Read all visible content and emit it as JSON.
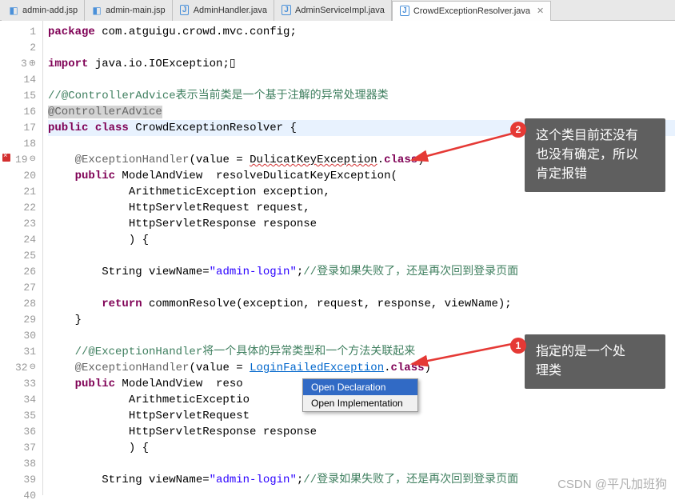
{
  "tabs": [
    {
      "label": "admin-add.jsp",
      "type": "jsp",
      "active": false
    },
    {
      "label": "admin-main.jsp",
      "type": "jsp",
      "active": false
    },
    {
      "label": "AdminHandler.java",
      "type": "java",
      "active": false
    },
    {
      "label": "AdminServiceImpl.java",
      "type": "java",
      "active": false
    },
    {
      "label": "CrowdExceptionResolver.java",
      "type": "java",
      "active": true
    }
  ],
  "gutter": {
    "start": 1,
    "lines": [
      {
        "n": "1"
      },
      {
        "n": "2"
      },
      {
        "n": "3",
        "plus": true,
        "fold": true,
        "dot": true
      },
      {
        "n": "14"
      },
      {
        "n": "15"
      },
      {
        "n": "16"
      },
      {
        "n": "17"
      },
      {
        "n": "18"
      },
      {
        "n": "19",
        "err": true,
        "fold": true
      },
      {
        "n": "20"
      },
      {
        "n": "21"
      },
      {
        "n": "22"
      },
      {
        "n": "23"
      },
      {
        "n": "24"
      },
      {
        "n": "25"
      },
      {
        "n": "26"
      },
      {
        "n": "27"
      },
      {
        "n": "28"
      },
      {
        "n": "29"
      },
      {
        "n": "30"
      },
      {
        "n": "31"
      },
      {
        "n": "32",
        "fold": true,
        "dot": true
      },
      {
        "n": "33"
      },
      {
        "n": "34"
      },
      {
        "n": "35"
      },
      {
        "n": "36"
      },
      {
        "n": "37"
      },
      {
        "n": "38"
      },
      {
        "n": "39"
      },
      {
        "n": "40"
      }
    ]
  },
  "code": {
    "l1": {
      "kw1": "package",
      "pkg": " com.atguigu.crowd.mvc.config;"
    },
    "l3": {
      "kw1": "import",
      "pkg": " java.io.IOException;"
    },
    "l15": {
      "cmt": "//@ControllerAdvice表示当前类是一个基于注解的异常处理器类"
    },
    "l16": {
      "ann": "@ControllerAdvice"
    },
    "l17": {
      "kw1": "public",
      "kw2": "class",
      "cls": " CrowdExceptionResolver {"
    },
    "l19": {
      "ann": "    @ExceptionHandler",
      "txt1": "(value = ",
      "err": "DulicatKeyException",
      "txt2": ".",
      "kw": "class",
      "txt3": ")"
    },
    "l20": {
      "kw1": "    public",
      "txt": " ModelAndView  resolveDulicatKeyException("
    },
    "l21": {
      "txt": "            ArithmeticException exception,"
    },
    "l22": {
      "txt": "            HttpServletRequest request,"
    },
    "l23": {
      "txt": "            HttpServletResponse response"
    },
    "l24": {
      "txt": "            ) {"
    },
    "l26": {
      "txt1": "        String viewName=",
      "str": "\"admin-login\"",
      "txt2": ";",
      "cmt": "//登录如果失败了，还是再次回到登录页面"
    },
    "l28": {
      "kw": "        return",
      "txt": " commonResolve(exception, request, response, viewName);"
    },
    "l29": {
      "txt": "    }"
    },
    "l31": {
      "cmt": "    //@ExceptionHandler将一个具体的异常类型和一个方法关联起来"
    },
    "l32": {
      "ann": "    @ExceptionHandler",
      "txt1": "(value = ",
      "link": "LoginFailedException",
      "txt2": ".",
      "kw": "class",
      "txt3": ")"
    },
    "l33": {
      "kw1": "    public",
      "txt": " ModelAndView  reso"
    },
    "l34": {
      "txt": "            ArithmeticExceptio"
    },
    "l35": {
      "txt": "            HttpServletRequest"
    },
    "l36": {
      "txt": "            HttpServletResponse response"
    },
    "l37": {
      "txt": "            ) {"
    },
    "l39": {
      "txt1": "        String viewName=",
      "str": "\"admin-login\"",
      "txt2": ";",
      "cmt": "//登录如果失败了，还是再次回到登录页面"
    }
  },
  "contextMenu": {
    "items": [
      {
        "label": "Open Declaration",
        "hover": true
      },
      {
        "label": "Open Implementation",
        "hover": false
      }
    ]
  },
  "callouts": {
    "c1": {
      "badge": "1",
      "text": "指定的是一个处\n理类"
    },
    "c2": {
      "badge": "2",
      "text": "这个类目前还没有\n也没有确定，所以\n肯定报错"
    }
  },
  "watermark": "CSDN @平凡加班狗"
}
